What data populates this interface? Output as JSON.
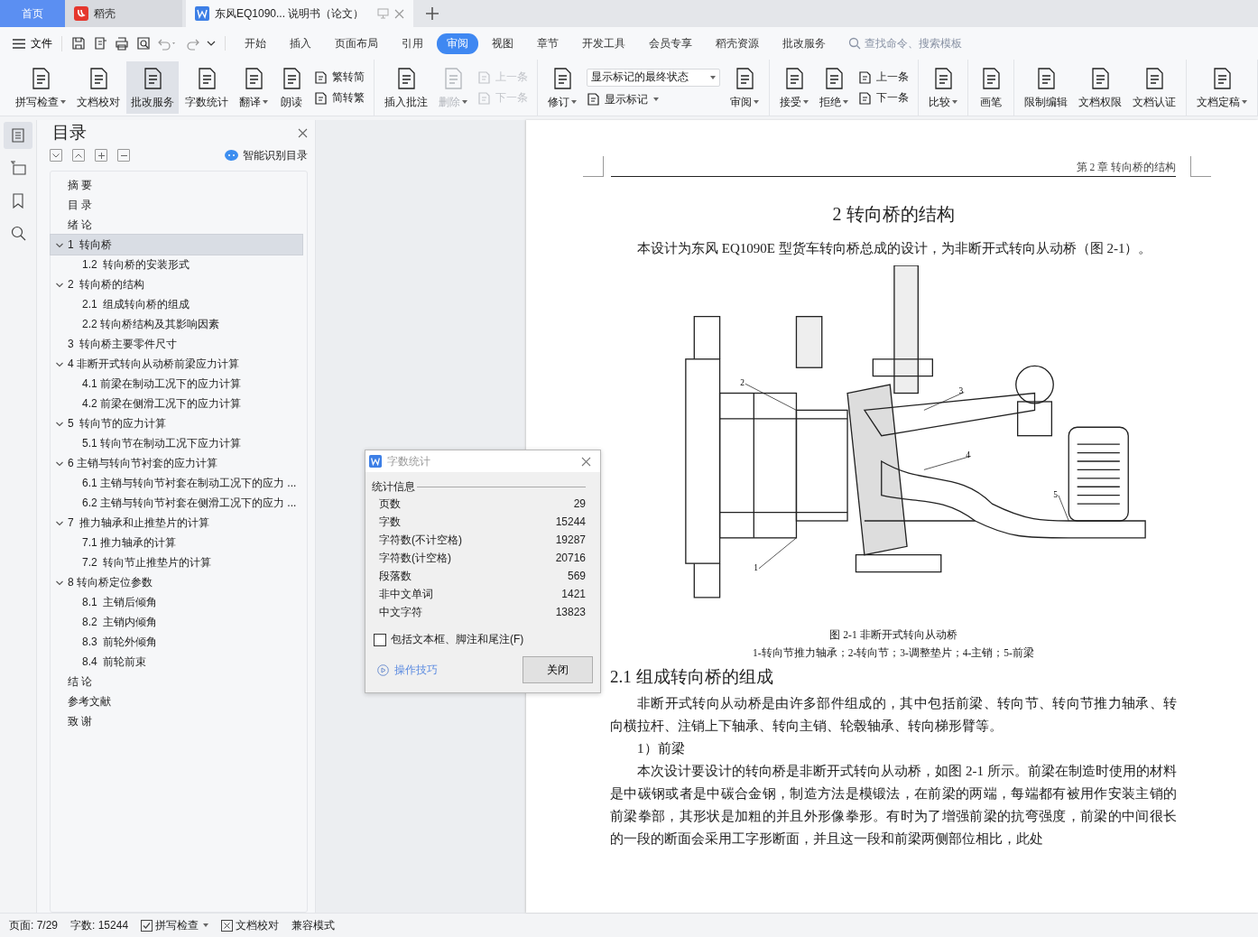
{
  "tabs": [
    {
      "kind": "home",
      "label": "首页",
      "selected": false
    },
    {
      "kind": "app",
      "label": "稻壳",
      "selected": false
    },
    {
      "kind": "doc",
      "label": "东风EQ1090... 说明书（论文）",
      "selected": true
    }
  ],
  "menu": {
    "file": "文件",
    "tabs": [
      {
        "label": "开始",
        "selected": false
      },
      {
        "label": "插入",
        "selected": false
      },
      {
        "label": "页面布局",
        "selected": false
      },
      {
        "label": "引用",
        "selected": false
      },
      {
        "label": "审阅",
        "selected": true
      },
      {
        "label": "视图",
        "selected": false
      },
      {
        "label": "章节",
        "selected": false
      },
      {
        "label": "开发工具",
        "selected": false
      },
      {
        "label": "会员专享",
        "selected": false
      },
      {
        "label": "稻壳资源",
        "selected": false
      },
      {
        "label": "批改服务",
        "selected": false
      }
    ],
    "search_placeholder": "查找命令、搜索模板"
  },
  "ribbon": [
    [
      {
        "kind": "large",
        "label": "拼写检查",
        "dropdown": true,
        "disabled": false,
        "selected": false
      },
      {
        "kind": "large",
        "label": "文档校对",
        "dropdown": false,
        "disabled": false,
        "selected": false
      },
      {
        "kind": "large",
        "label": "批改服务",
        "dropdown": false,
        "disabled": false,
        "selected": true
      },
      {
        "kind": "large",
        "label": "字数统计",
        "dropdown": false,
        "disabled": false,
        "selected": false
      },
      {
        "kind": "large",
        "label": "翻译",
        "dropdown": true,
        "disabled": false,
        "selected": false
      },
      {
        "kind": "large",
        "label": "朗读",
        "dropdown": false,
        "disabled": false,
        "selected": false
      },
      {
        "kind": "stack",
        "items": [
          {
            "kind": "button",
            "label": "繁转简",
            "dropdown": false,
            "disabled": false
          },
          {
            "kind": "button",
            "label": "简转繁",
            "dropdown": false,
            "disabled": false
          }
        ]
      }
    ],
    [
      {
        "kind": "large",
        "label": "插入批注",
        "dropdown": false,
        "disabled": false,
        "selected": false
      },
      {
        "kind": "large",
        "label": "删除",
        "dropdown": true,
        "disabled": true,
        "selected": false
      },
      {
        "kind": "stack",
        "items": [
          {
            "kind": "button",
            "label": "上一条",
            "dropdown": false,
            "disabled": true
          },
          {
            "kind": "button",
            "label": "下一条",
            "dropdown": false,
            "disabled": true
          }
        ]
      }
    ],
    [
      {
        "kind": "large",
        "label": "修订",
        "dropdown": true,
        "disabled": false,
        "selected": false
      },
      {
        "kind": "stack",
        "items": [
          {
            "kind": "select",
            "label": "显示标记的最终状态",
            "dropdown": true,
            "disabled": false
          },
          {
            "kind": "button",
            "label": "显示标记",
            "dropdown": true,
            "disabled": false
          }
        ]
      },
      {
        "kind": "large",
        "label": "审阅",
        "dropdown": true,
        "disabled": false,
        "selected": false
      }
    ],
    [
      {
        "kind": "large",
        "label": "接受",
        "dropdown": true,
        "disabled": false,
        "selected": false
      },
      {
        "kind": "large",
        "label": "拒绝",
        "dropdown": true,
        "disabled": false,
        "selected": false
      },
      {
        "kind": "stack",
        "items": [
          {
            "kind": "button",
            "label": "上一条",
            "dropdown": false,
            "disabled": false
          },
          {
            "kind": "button",
            "label": "下一条",
            "dropdown": false,
            "disabled": false
          }
        ]
      }
    ],
    [
      {
        "kind": "large",
        "label": "比较",
        "dropdown": true,
        "disabled": false,
        "selected": false
      }
    ],
    [
      {
        "kind": "large",
        "label": "画笔",
        "dropdown": false,
        "disabled": false,
        "selected": false
      }
    ],
    [
      {
        "kind": "large",
        "label": "限制编辑",
        "dropdown": false,
        "disabled": false,
        "selected": false
      },
      {
        "kind": "large",
        "label": "文档权限",
        "dropdown": false,
        "disabled": false,
        "selected": false
      },
      {
        "kind": "large",
        "label": "文档认证",
        "dropdown": false,
        "disabled": false,
        "selected": false
      }
    ],
    [
      {
        "kind": "large",
        "label": "文档定稿",
        "dropdown": true,
        "disabled": false,
        "selected": false
      }
    ]
  ],
  "rail": [
    {
      "selected": true
    },
    {
      "selected": false
    },
    {
      "selected": false
    },
    {
      "selected": false
    }
  ],
  "toc": {
    "title": "目录",
    "smart": "智能识别目录",
    "items": [
      {
        "label": "摘 要",
        "selected": false
      },
      {
        "label": "目 录",
        "selected": false
      },
      {
        "label": "绪 论",
        "selected": false
      },
      {
        "label": "1  转向桥",
        "selected": true,
        "expanded": true,
        "children": [
          {
            "label": "1.2  转向桥的安装形式",
            "selected": false
          }
        ]
      },
      {
        "label": "2  转向桥的结构",
        "selected": false,
        "expanded": true,
        "children": [
          {
            "label": "2.1  组成转向桥的组成",
            "selected": false
          },
          {
            "label": "2.2 转向桥结构及其影响因素",
            "selected": false
          }
        ]
      },
      {
        "label": "3  转向桥主要零件尺寸",
        "selected": false
      },
      {
        "label": "4 非断开式转向从动桥前梁应力计算",
        "selected": false,
        "expanded": true,
        "children": [
          {
            "label": "4.1 前梁在制动工况下的应力计算",
            "selected": false
          },
          {
            "label": "4.2 前梁在侧滑工况下的应力计算",
            "selected": false
          }
        ]
      },
      {
        "label": "5  转向节的应力计算",
        "selected": false,
        "expanded": true,
        "children": [
          {
            "label": "5.1 转向节在制动工况下应力计算",
            "selected": false
          }
        ]
      },
      {
        "label": "6 主销与转向节衬套的应力计算",
        "selected": false,
        "expanded": true,
        "children": [
          {
            "label": "6.1 主销与转向节衬套在制动工况下的应力 ...",
            "selected": false
          },
          {
            "label": "6.2 主销与转向节衬套在侧滑工况下的应力 ...",
            "selected": false
          }
        ]
      },
      {
        "label": "7  推力轴承和止推垫片的计算",
        "selected": false,
        "expanded": true,
        "children": [
          {
            "label": "7.1 推力轴承的计算",
            "selected": false
          },
          {
            "label": "7.2  转向节止推垫片的计算",
            "selected": false
          }
        ]
      },
      {
        "label": "8 转向桥定位参数",
        "selected": false,
        "expanded": true,
        "children": [
          {
            "label": "8.1  主销后倾角",
            "selected": false
          },
          {
            "label": "8.2  主销内倾角",
            "selected": false
          },
          {
            "label": "8.3  前轮外倾角",
            "selected": false
          },
          {
            "label": "8.4  前轮前束",
            "selected": false
          }
        ]
      },
      {
        "label": "结 论",
        "selected": false
      },
      {
        "label": "参考文献",
        "selected": false
      },
      {
        "label": "致 谢",
        "selected": false
      }
    ]
  },
  "dialog": {
    "title": "字数统计",
    "section": "统计信息",
    "stats": [
      {
        "label": "页数",
        "value": "29"
      },
      {
        "label": "字数",
        "value": "15244"
      },
      {
        "label": "字符数(不计空格)",
        "value": "19287"
      },
      {
        "label": "字符数(计空格)",
        "value": "20716"
      },
      {
        "label": "段落数",
        "value": "569"
      },
      {
        "label": "非中文单词",
        "value": "1421"
      },
      {
        "label": "中文字符",
        "value": "13823"
      }
    ],
    "option": {
      "label": "包括文本框、脚注和尾注(F)",
      "checked": false
    },
    "tips": "操作技巧",
    "close": "关闭"
  },
  "document": {
    "header": "第 2 章  转向桥的结构",
    "title": "2  转向桥的结构",
    "intro": "本设计为东风 EQ1090E 型货车转向桥总成的设计，为非断开式转向从动桥（图 2-1）。",
    "figure": {
      "callouts": [
        "1",
        "2",
        "3",
        "4",
        "5"
      ],
      "caption": "图 2-1  非断开式转向从动桥",
      "legend": "1-转向节推力轴承；2-转向节；3-调整垫片；4-主销；5-前梁"
    },
    "section": "2.1  组成转向桥的组成",
    "paragraphs": [
      {
        "kind": "body",
        "text": "非断开式转向从动桥是由许多部件组成的，其中包括前梁、转向节、转向节推力轴承、转向横拉杆、注销上下轴承、转向主销、轮毂轴承、转向梯形臂等。"
      },
      {
        "kind": "item",
        "text": "1）前梁"
      },
      {
        "kind": "body",
        "text": "本次设计要设计的转向桥是非断开式转向从动桥，如图 2-1 所示。前梁在制造时使用的材料是中碳钢或者是中碳合金钢，制造方法是模锻法，在前梁的两端，每端都有被用作安装主销的前梁拳部，其形状是加粗的并且外形像拳形。有时为了增强前梁的抗弯强度，前梁的中间很长的一段的断面会采用工字形断面，并且这一段和前梁两侧部位相比，此处"
      }
    ]
  },
  "status": [
    {
      "kind": "text",
      "label": "页面: 7/29",
      "dropdown": false
    },
    {
      "kind": "text",
      "label": "字数: 15244",
      "dropdown": false
    },
    {
      "kind": "check",
      "label": "拼写检查",
      "dropdown": true
    },
    {
      "kind": "box",
      "label": "文档校对",
      "dropdown": false
    },
    {
      "kind": "text",
      "label": "兼容模式",
      "dropdown": false
    }
  ]
}
